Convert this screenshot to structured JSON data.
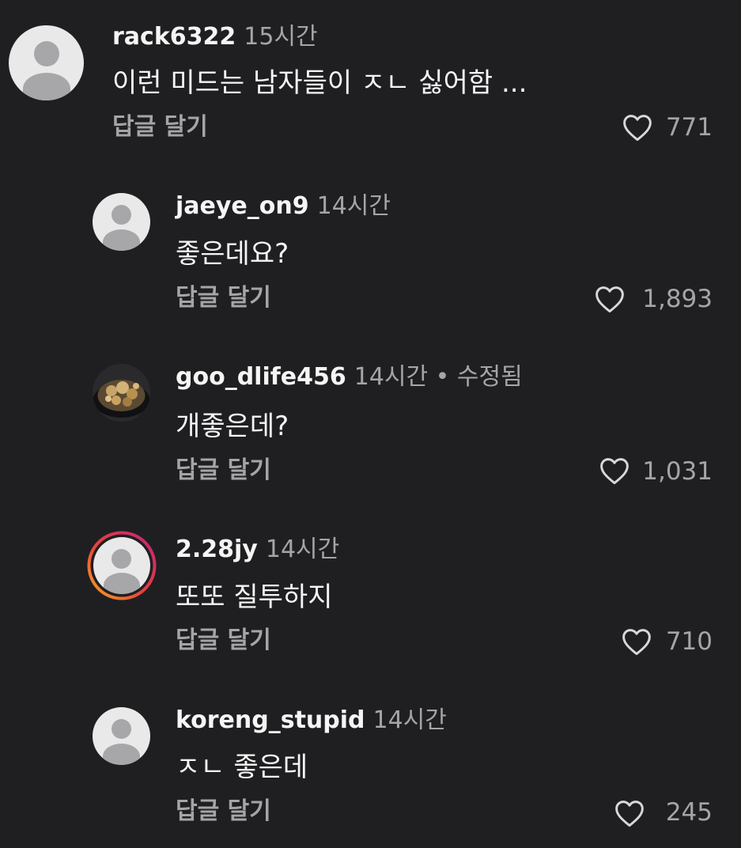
{
  "comments": [
    {
      "username": "rack6322",
      "time": "15시간",
      "text": "이런 미드는 남자들이 ㅈㄴ 싫어함 ...",
      "reply_label": "답글 달기",
      "likes": "771",
      "avatar": "default-avatar"
    },
    {
      "username": "jaeye_on9",
      "time": "14시간",
      "text": "좋은데요?",
      "reply_label": "답글 달기",
      "likes": "1,893",
      "avatar": "default-avatar"
    },
    {
      "username": "goo_dlife456",
      "time": "14시간 • 수정됨",
      "text": "개좋은데?",
      "reply_label": "답글 달기",
      "likes": "1,031",
      "avatar": "food-photo-avatar"
    },
    {
      "username": "2.28jy",
      "time": "14시간",
      "text": "또또 질투하지",
      "reply_label": "답글 달기",
      "likes": "710",
      "avatar": "story-ring-avatar"
    },
    {
      "username": "koreng_stupid",
      "time": "14시간",
      "text": "ㅈㄴ 좋은데",
      "reply_label": "답글 달기",
      "likes": "245",
      "avatar": "default-avatar"
    }
  ],
  "colors": {
    "background": "#1f1f21",
    "primary_text": "#f5f5f5",
    "secondary_text": "#a5a5a8",
    "avatar_bg": "#e9e9ea",
    "avatar_fg": "#a7a7aa"
  }
}
